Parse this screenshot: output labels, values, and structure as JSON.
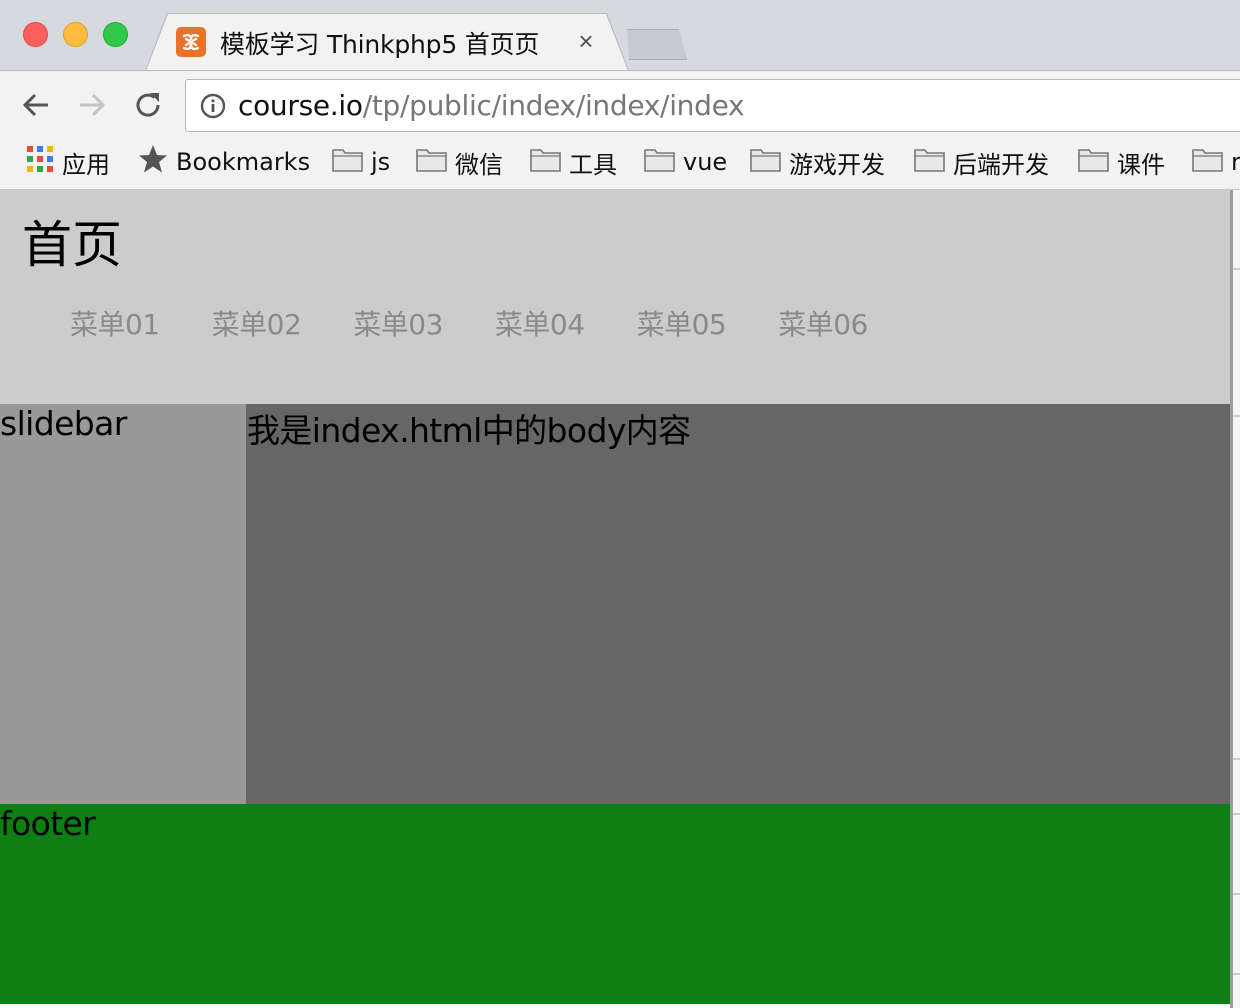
{
  "browser": {
    "tab": {
      "title": "模板学习 Thinkphp5 首页页",
      "close_label": "×"
    },
    "address": {
      "host": "course.io",
      "path": "/tp/public/index/index/index"
    },
    "bookmarks": [
      {
        "label": "应用",
        "icon": "apps-grid-icon"
      },
      {
        "label": "Bookmarks",
        "icon": "star-icon"
      },
      {
        "label": "js",
        "icon": "folder-icon"
      },
      {
        "label": "微信",
        "icon": "folder-icon"
      },
      {
        "label": "工具",
        "icon": "folder-icon"
      },
      {
        "label": "vue",
        "icon": "folder-icon"
      },
      {
        "label": "游戏开发",
        "icon": "folder-icon"
      },
      {
        "label": "后端开发",
        "icon": "folder-icon"
      },
      {
        "label": "课件",
        "icon": "folder-icon"
      },
      {
        "label": "r",
        "icon": "folder-icon"
      }
    ]
  },
  "page": {
    "title": "首页",
    "menu": [
      "菜单01",
      "菜单02",
      "菜单03",
      "菜单04",
      "菜单05",
      "菜单06"
    ],
    "slidebar_text": "slidebar",
    "body_text": "我是index.html中的body内容",
    "footer_text": "footer"
  },
  "colors": {
    "header_bg": "#cccccc",
    "slidebar_bg": "#999999",
    "main_bg": "#666666",
    "footer_bg": "#0e7f12",
    "menu_text": "#8a8a8a"
  }
}
